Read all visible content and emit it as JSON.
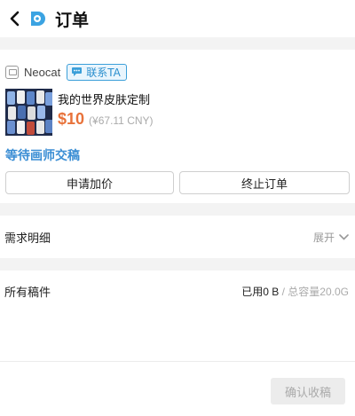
{
  "header": {
    "title": "订单",
    "back_icon": "chevron-left-icon",
    "logo_icon": "app-logo-icon",
    "logo_color": "#3ba3e2"
  },
  "order": {
    "seller_name": "Neocat",
    "contact_label": "联系TA",
    "product_name": "我的世界皮肤定制",
    "price": "$10",
    "price_cny": "(¥67.11 CNY)",
    "status": "等待画师交稿",
    "actions": {
      "left_label": "申请加价",
      "right_label": "终止订单"
    },
    "accent_price_color": "#e8723a",
    "accent_status_color": "#3b8ed4"
  },
  "requirements": {
    "title": "需求明细",
    "expand_label": "展开"
  },
  "files": {
    "title": "所有稿件",
    "used": "已用0 B",
    "total": " / 总容量20.0G"
  },
  "footer": {
    "confirm_label": "确认收稿"
  }
}
